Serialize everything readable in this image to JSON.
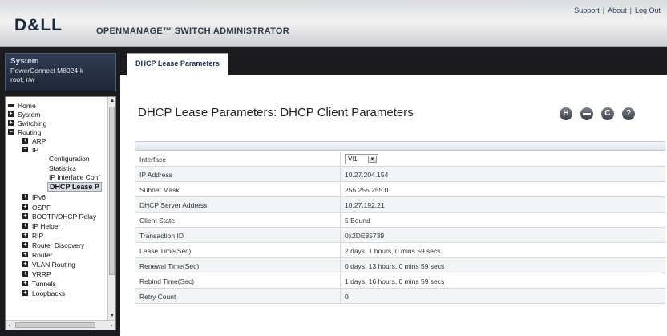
{
  "header": {
    "logo_text": "D&LL",
    "app_title": "OPENMANAGE™ SWITCH ADMINISTRATOR",
    "links": [
      "Support",
      "About",
      "Log Out"
    ]
  },
  "system": {
    "title": "System",
    "model": "PowerConnect M8024-k",
    "user": "root, r/w"
  },
  "nav": {
    "items": [
      {
        "label": "Home",
        "type": "dash"
      },
      {
        "label": "System",
        "type": "plus"
      },
      {
        "label": "Switching",
        "type": "plus"
      },
      {
        "label": "Routing",
        "type": "minus"
      },
      {
        "label": "ARP",
        "type": "plus"
      },
      {
        "label": "IP",
        "type": "minus"
      },
      {
        "label": "Configuration",
        "type": "leaf"
      },
      {
        "label": "Statistics",
        "type": "leaf"
      },
      {
        "label": "IP Interface Conf",
        "type": "leaf"
      },
      {
        "label": "DHCP Lease P",
        "type": "selected"
      },
      {
        "label": "IPv6",
        "type": "plus"
      },
      {
        "label": "OSPF",
        "type": "plus"
      },
      {
        "label": "BOOTP/DHCP Relay",
        "type": "plus"
      },
      {
        "label": "IP Helper",
        "type": "plus"
      },
      {
        "label": "RIP",
        "type": "plus"
      },
      {
        "label": "Router Discovery",
        "type": "plus"
      },
      {
        "label": "Router",
        "type": "plus"
      },
      {
        "label": "VLAN Routing",
        "type": "plus"
      },
      {
        "label": "VRRP",
        "type": "plus"
      },
      {
        "label": "Tunnels",
        "type": "plus"
      },
      {
        "label": "Loopbacks",
        "type": "plus"
      }
    ]
  },
  "tab": {
    "label": "DHCP Lease Parameters"
  },
  "page": {
    "title": "DHCP Lease Parameters: DHCP Client Parameters",
    "icons": [
      "H",
      "print",
      "C",
      "?"
    ]
  },
  "table": {
    "rows": [
      {
        "label": "Interface",
        "value": "Vl1"
      },
      {
        "label": "IP Address",
        "value": "10.27.204.154"
      },
      {
        "label": "Subnet Mask",
        "value": "255.255.255.0"
      },
      {
        "label": "DHCP Server Address",
        "value": "10.27.192.21"
      },
      {
        "label": "Client State",
        "value": "5 Bound"
      },
      {
        "label": "Transaction ID",
        "value": "0x2DE85739"
      },
      {
        "label": "Lease Time(Sec)",
        "value": "2 days, 1 hours, 0 mins 59 secs"
      },
      {
        "label": "Renewal Time(Sec)",
        "value": "0 days, 13 hours, 0 mins 59 secs"
      },
      {
        "label": "Rebind Time(Sec)",
        "value": "1 days, 16 hours, 0 mins 59 secs"
      },
      {
        "label": "Retry Count",
        "value": "0"
      }
    ]
  }
}
